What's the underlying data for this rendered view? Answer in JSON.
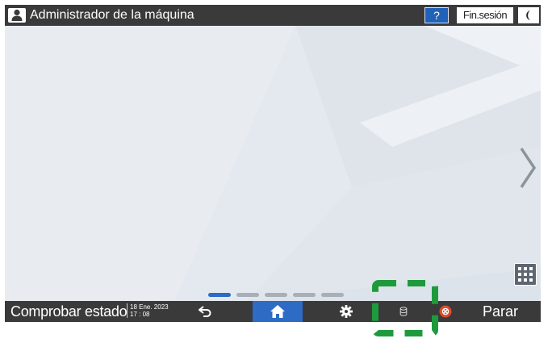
{
  "topbar": {
    "user_icon": "user-icon",
    "user_title": "Administrador de la máquina",
    "help_label": "?",
    "logout_label": "Fin.sesión",
    "sleep_icon": "moon-icon"
  },
  "main": {
    "next_icon": "chevron-right-icon",
    "apps_icon": "grid-icon",
    "pages_total": 5,
    "current_page": 1
  },
  "bottombar": {
    "status_label": "Comprobar estado",
    "date": "18 Ene. 2023",
    "time": "17 : 08",
    "back_icon": "back-arrow-icon",
    "home_icon": "home-icon",
    "settings_icon": "gear-icon",
    "data_icon": "data-storage-icon",
    "stop_icon": "stop-icon",
    "stop_label": "Parar"
  },
  "colors": {
    "bar": "#3a3a3a",
    "accent": "#2d6bc4",
    "highlight": "#1e9a3c",
    "stop": "#e04a2a"
  }
}
